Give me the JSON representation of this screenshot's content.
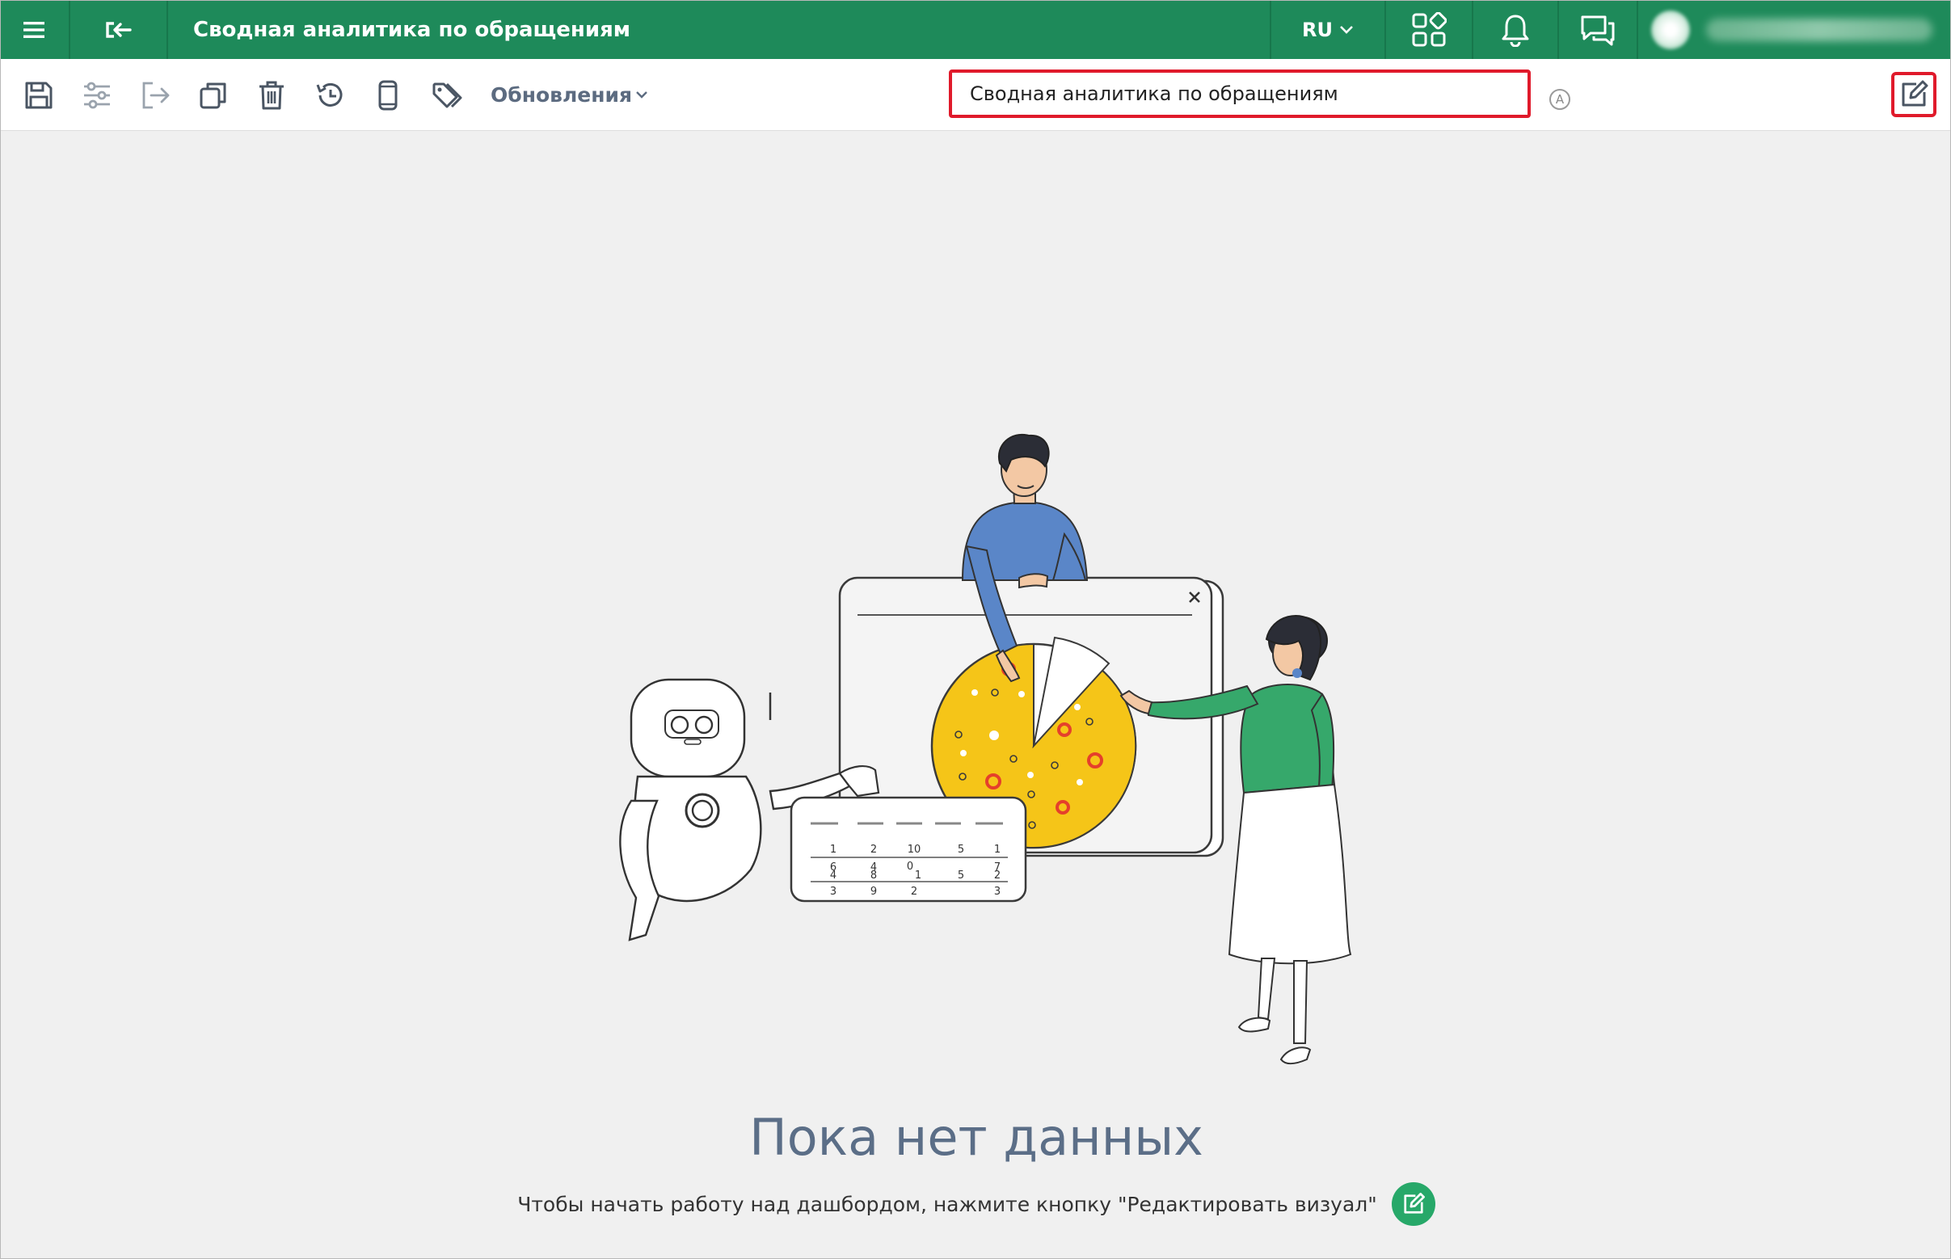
{
  "header": {
    "title": "Сводная аналитика по обращениям",
    "language": "RU",
    "user": {
      "name": ""
    },
    "colors": {
      "brand": "#1e8a5a",
      "accent": "#27a869",
      "highlight": "#e01a2b"
    }
  },
  "toolbar": {
    "tools": [
      {
        "name": "save-icon"
      },
      {
        "name": "filters-icon"
      },
      {
        "name": "export-icon"
      },
      {
        "name": "copy-icon"
      },
      {
        "name": "delete-icon"
      },
      {
        "name": "history-icon"
      },
      {
        "name": "mobile-view-icon"
      },
      {
        "name": "tag-icon"
      }
    ],
    "updates_label": "Обновления",
    "dashboard_name": "Сводная аналитика по обращениям",
    "ai_badge": "A",
    "edit_visual_icon": "pencil-square-icon"
  },
  "empty_state": {
    "title": "Пока нет данных",
    "hint": "Чтобы начать работу над дашбордом, нажмите кнопку \"Редактировать визуал\"",
    "illustration": "people-and-robot-with-pie-chart",
    "table_rows": [
      [
        "1",
        "2",
        "10",
        "5",
        "1"
      ],
      [
        "6",
        "4",
        "0",
        "",
        "7"
      ],
      [
        "4",
        "8",
        "1",
        "5",
        "2"
      ],
      [
        "3",
        "9",
        "2",
        "",
        "3"
      ]
    ]
  }
}
